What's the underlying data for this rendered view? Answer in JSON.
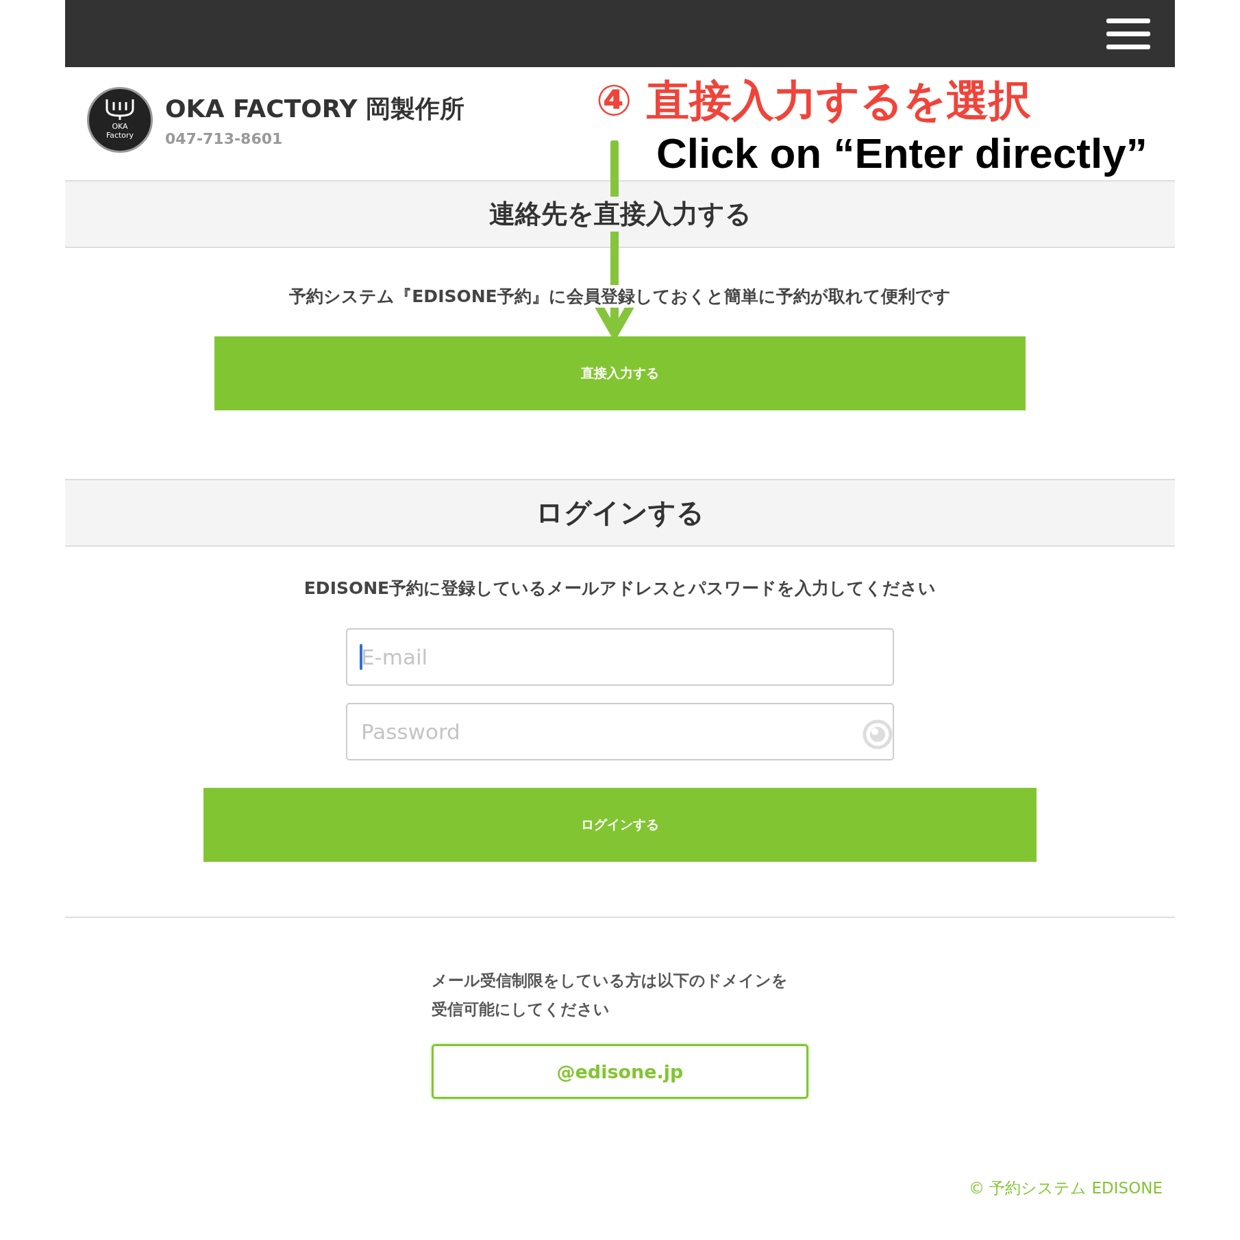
{
  "header": {
    "logo": {
      "line1": "OKA",
      "line2": "Factory"
    },
    "name": "OKA FACTORY 岡製作所",
    "phone": "047-713-8601"
  },
  "annotation": {
    "step": "④",
    "title": "直接入力するを選択",
    "caption": "Click on “Enter directly”"
  },
  "direct": {
    "heading": "連絡先を直接入力する",
    "text": "予約システム『EDISONE予約』に会員登録しておくと簡単に予約が取れて便利です",
    "button": "直接入力する"
  },
  "login": {
    "heading": "ログインする",
    "text": "EDISONE予約に登録しているメールアドレスとパスワードを入力してください",
    "fields": [
      {
        "kind": "email",
        "placeholder": "E-mail",
        "focused": true
      },
      {
        "kind": "password",
        "placeholder": "Password",
        "focused": false
      }
    ],
    "button": "ログインする"
  },
  "notice": {
    "lines": [
      "メール受信制限をしている方は以下のドメインを",
      "受信可能にしてください"
    ],
    "domain": "@edisone.jp"
  },
  "footer": "© 予約システム EDISONE"
}
